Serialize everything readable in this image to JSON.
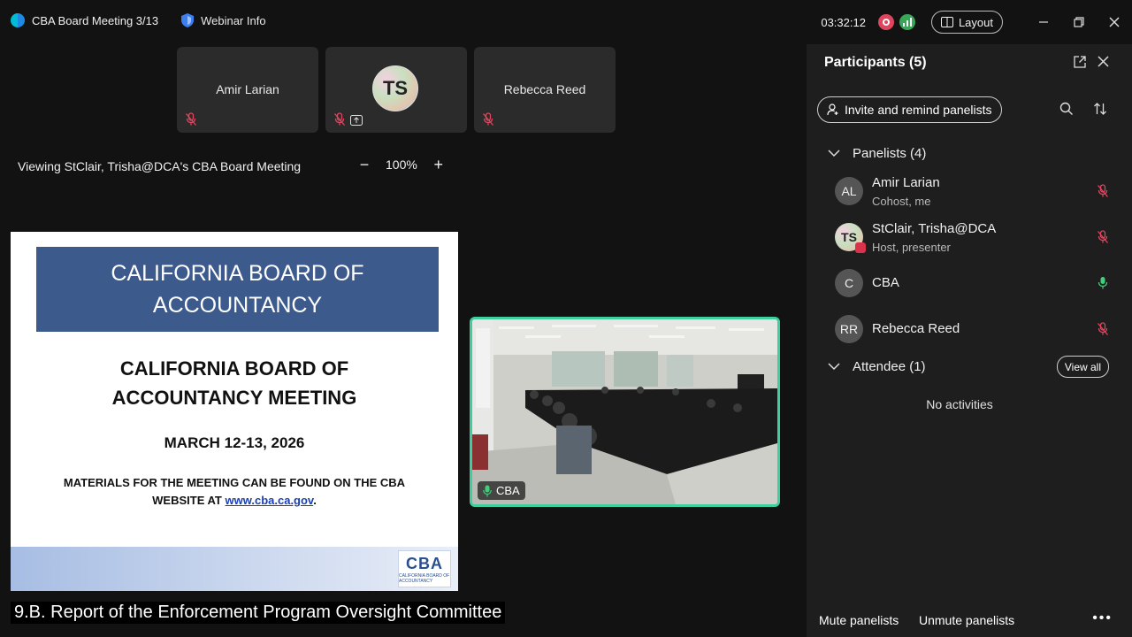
{
  "titlebar": {
    "meeting_title": "CBA Board Meeting 3/13",
    "webinar_info": "Webinar Info",
    "clock": "03:32:12",
    "layout_label": "Layout"
  },
  "thumbnails": [
    {
      "name": "Amir Larian"
    },
    {
      "initials": "TS"
    },
    {
      "name": "Rebecca Reed"
    }
  ],
  "share": {
    "viewing_text": "Viewing StClair, Trisha@DCA's CBA Board Meeting",
    "zoom_level": "100%"
  },
  "slide": {
    "banner": "CALIFORNIA BOARD OF ACCOUNTANCY",
    "heading": "CALIFORNIA BOARD OF ACCOUNTANCY MEETING",
    "date": "MARCH 12-13, 2026",
    "materials_text": "MATERIALS FOR THE MEETING CAN BE FOUND ON THE CBA WEBSITE AT",
    "materials_link": "www.cba.ca.gov",
    "materials_end": ".",
    "logo_text": "CBA",
    "logo_sub": "CALIFORNIA BOARD OF ACCOUNTANCY"
  },
  "caption": "9.B. Report of the Enforcement Program Oversight Committee",
  "video": {
    "label": "CBA"
  },
  "participants": {
    "title": "Participants (5)",
    "invite_label": "Invite and remind panelists",
    "panelists_header": "Panelists (4)",
    "panelists": [
      {
        "initials": "AL",
        "name": "Amir Larian",
        "role": "Cohost, me",
        "mic": "muted"
      },
      {
        "initials": "TS",
        "name": "StClair, Trisha@DCA",
        "role": "Host, presenter",
        "mic": "muted"
      },
      {
        "initials": "C",
        "name": "CBA",
        "role": "",
        "mic": "on"
      },
      {
        "initials": "RR",
        "name": "Rebecca Reed",
        "role": "",
        "mic": "muted"
      }
    ],
    "attendee_header": "Attendee (1)",
    "view_all_label": "View all",
    "no_activities": "No activities",
    "mute_label": "Mute panelists",
    "unmute_label": "Unmute panelists",
    "more_label": "•••"
  },
  "colors": {
    "muted_mic": "#e0455e",
    "active_mic": "#3fcf7a",
    "video_border": "#3fcf9f",
    "banner": "#3c5a8c"
  }
}
